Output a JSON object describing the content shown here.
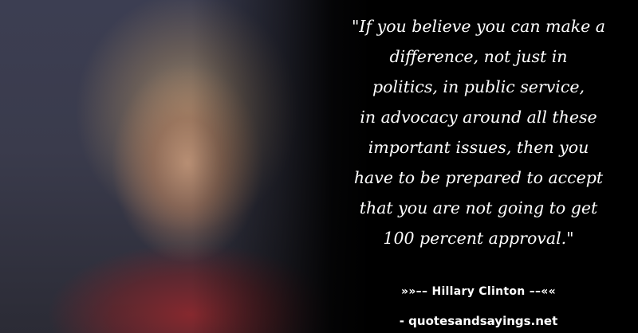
{
  "quote": {
    "lines": [
      "\"If you believe you can make a",
      "difference, not just in",
      "politics, in public service,",
      "in advocacy around all these",
      "important issues, then you",
      "have to be prepared to accept",
      "that you are not going to get",
      "100 percent approval.\""
    ]
  },
  "author": "»»–– Hillary Clinton ––««",
  "source": "- quotesandsayings.net",
  "colors": {
    "background": "#000000",
    "text": "#ffffff"
  }
}
